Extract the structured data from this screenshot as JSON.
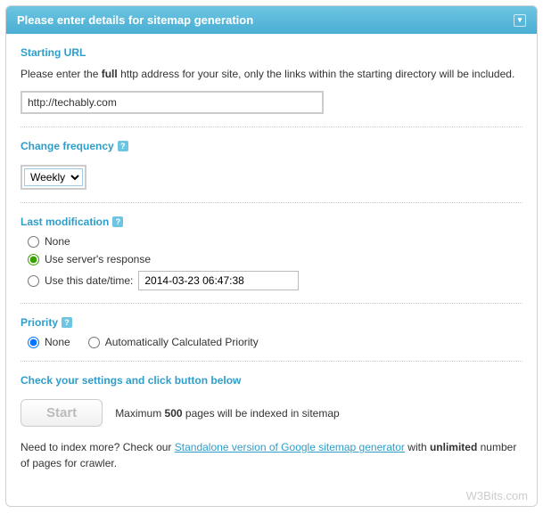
{
  "header": {
    "title": "Please enter details for sitemap generation"
  },
  "starting_url": {
    "label": "Starting URL",
    "desc_pre": "Please enter the ",
    "desc_bold": "full",
    "desc_post": " http address for your site, only the links within the starting directory will be included.",
    "value": "http://techably.com"
  },
  "change_freq": {
    "label": "Change frequency",
    "selected": "Weekly"
  },
  "last_mod": {
    "label": "Last modification",
    "options": {
      "none": "None",
      "server": "Use server's response",
      "this_date": "Use this date/time:"
    },
    "date_value": "2014-03-23 06:47:38"
  },
  "priority": {
    "label": "Priority",
    "options": {
      "none": "None",
      "auto": "Automatically Calculated Priority"
    }
  },
  "check": {
    "label": "Check your settings and click button below",
    "start_btn": "Start",
    "max_pre": "Maximum ",
    "max_bold": "500",
    "max_post": " pages will be indexed in sitemap"
  },
  "more": {
    "pre": "Need to index more? Check our ",
    "link": "Standalone version of Google sitemap generator",
    "post_pre": " with ",
    "post_bold": "unlimited",
    "post_post": " number of pages for crawler."
  },
  "watermark": "W3Bits.com"
}
